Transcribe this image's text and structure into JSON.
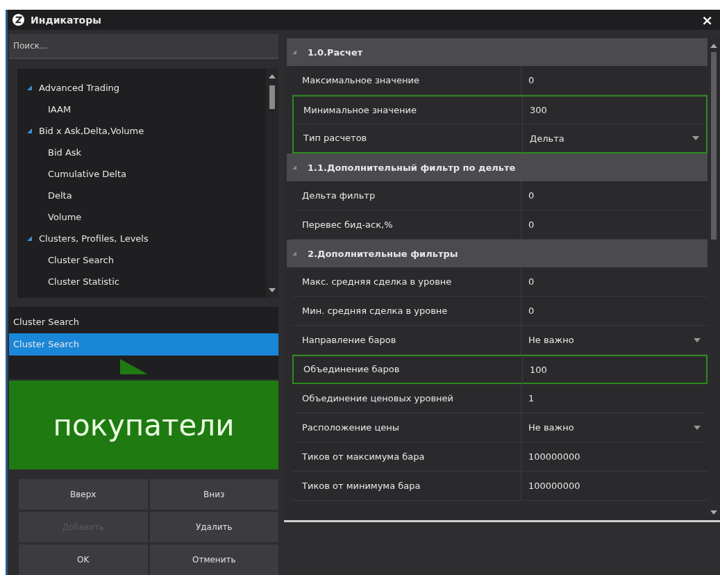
{
  "window": {
    "title": "Индикаторы",
    "close": "×"
  },
  "search": {
    "placeholder": "Поиск..."
  },
  "tree": [
    {
      "label": "Advanced Trading",
      "expanded": true,
      "children": [
        {
          "label": "IAAM"
        }
      ]
    },
    {
      "label": "Bid x Ask,Delta,Volume",
      "expanded": true,
      "children": [
        {
          "label": "Bid Ask"
        },
        {
          "label": "Cumulative Delta"
        },
        {
          "label": "Delta"
        },
        {
          "label": "Volume"
        }
      ]
    },
    {
      "label": "Clusters, Profiles, Levels",
      "expanded": true,
      "children": [
        {
          "label": "Cluster Search"
        },
        {
          "label": "Cluster Statistic"
        }
      ]
    }
  ],
  "added": [
    {
      "label": "Cluster Search",
      "selected": false
    },
    {
      "label": "Cluster Search",
      "selected": true
    }
  ],
  "callout": {
    "text": "покупатели"
  },
  "buttons": [
    {
      "label": "Вверх",
      "disabled": false
    },
    {
      "label": "Вниз",
      "disabled": false
    },
    {
      "label": "Добавить",
      "disabled": true
    },
    {
      "label": "Удалить",
      "disabled": false
    },
    {
      "label": "OK",
      "disabled": false
    },
    {
      "label": "Отменить",
      "disabled": false
    }
  ],
  "properties": [
    {
      "title": "1.0.Расчет",
      "expanded": true,
      "rows": [
        {
          "name": "Максимальное значение",
          "value": "0",
          "kind": "text",
          "highlighted": false
        },
        {
          "name": "Минимальное значение",
          "value": "300",
          "kind": "text",
          "highlighted": true
        },
        {
          "name": "Тип расчетов",
          "value": "Дельта",
          "kind": "dropdown",
          "highlighted": true
        }
      ]
    },
    {
      "title": "1.1.Дополнительный фильтр по дельте",
      "expanded": true,
      "rows": [
        {
          "name": "Дельта фильтр",
          "value": "0",
          "kind": "text",
          "highlighted": false
        },
        {
          "name": "Перевес бид-аск,%",
          "value": "0",
          "kind": "text",
          "highlighted": false
        }
      ]
    },
    {
      "title": "2.Дополнительные фильтры",
      "expanded": true,
      "rows": [
        {
          "name": "Макс. средняя сделка в уровне",
          "value": "0",
          "kind": "text",
          "highlighted": false
        },
        {
          "name": "Мин. средняя сделка в уровне",
          "value": "0",
          "kind": "text",
          "highlighted": false
        },
        {
          "name": "Направление баров",
          "value": "Не важно",
          "kind": "dropdown",
          "highlighted": false
        },
        {
          "name": "Объединение баров",
          "value": "100",
          "kind": "text",
          "highlighted": true
        },
        {
          "name": "Объединение ценовых уровней",
          "value": "1",
          "kind": "text",
          "highlighted": false
        },
        {
          "name": "Расположение цены",
          "value": "Не важно",
          "kind": "dropdown",
          "highlighted": false
        },
        {
          "name": "Тиков от максимума бара",
          "value": "100000000",
          "kind": "text",
          "highlighted": false
        },
        {
          "name": "Тиков от минимума бара",
          "value": "100000000",
          "kind": "text",
          "highlighted": false
        }
      ]
    }
  ]
}
